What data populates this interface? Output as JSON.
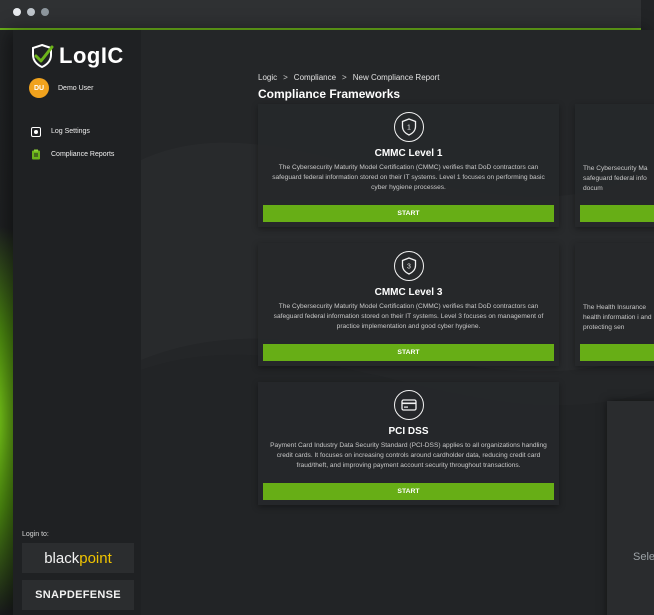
{
  "window": {
    "dots": [
      "close",
      "minimize",
      "maximize"
    ]
  },
  "brand": {
    "logo_text": "LogIC"
  },
  "user": {
    "initials": "DU",
    "name": "Demo User"
  },
  "nav": [
    {
      "label": "Log Settings",
      "icon": "gear-icon"
    },
    {
      "label": "Compliance Reports",
      "icon": "clipboard-icon"
    }
  ],
  "login": {
    "label": "Login to:",
    "blackpoint_a": "black",
    "blackpoint_b": "point",
    "snapdefense": "SNAPDEFENSE"
  },
  "breadcrumb": [
    "Logic",
    "Compliance",
    "New Compliance Report"
  ],
  "page_title": "Compliance Frameworks",
  "cards": [
    {
      "title": "CMMC Level 1",
      "badge": "1",
      "description": "The Cybersecurity Maturity Model Certification (CMMC) verifies that DoD contractors can safeguard federal information stored on their IT systems. Level 1 focuses on performing basic cyber hygiene processes.",
      "button": "START"
    },
    {
      "title": "",
      "description": "The Cybersecurity Ma safeguard federal info docum",
      "button": ""
    },
    {
      "title": "CMMC Level 3",
      "badge": "3",
      "description": "The Cybersecurity Maturity Model Certification (CMMC) verifies that DoD contractors can safeguard federal information stored on their IT systems. Level 3 focuses on management of practice implementation and good cyber hygiene.",
      "button": "START"
    },
    {
      "title": "",
      "description": "The Health Insurance health information i and protecting sen",
      "button": ""
    },
    {
      "title": "PCI DSS",
      "description": "Payment Card Industry Data Security Standard (PCI-DSS) applies to all organizations handling credit cards. It focuses on increasing controls around cardholder data, reducing credit card fraud/theft, and improving payment account security throughout transactions.",
      "button": "START"
    }
  ],
  "panel": {
    "text": "Select"
  },
  "colors": {
    "accent": "#67ae16",
    "avatar": "#f0a21d",
    "background": "#242628"
  }
}
